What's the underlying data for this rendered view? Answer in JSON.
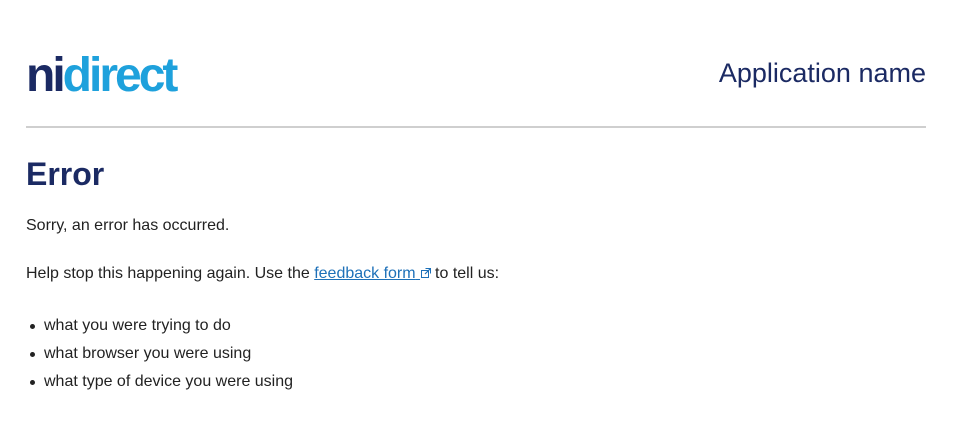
{
  "header": {
    "logo": {
      "part1": "ni",
      "part2": "direct"
    },
    "app_name": "Application name"
  },
  "main": {
    "title": "Error",
    "message": "Sorry, an error has occurred.",
    "help": {
      "before_link": "Help stop this happening again. Use the ",
      "link_text": "feedback form",
      "after_link": "to tell us:",
      "link_icon": "external-link-icon"
    },
    "reasons": [
      "what you were trying to do",
      "what browser you were using",
      "what type of device you were using"
    ]
  },
  "colors": {
    "brand_navy": "#1b2a63",
    "brand_blue": "#1ea1dc",
    "link": "#1d70b8",
    "divider": "#cfcfcf",
    "text": "#222222"
  }
}
